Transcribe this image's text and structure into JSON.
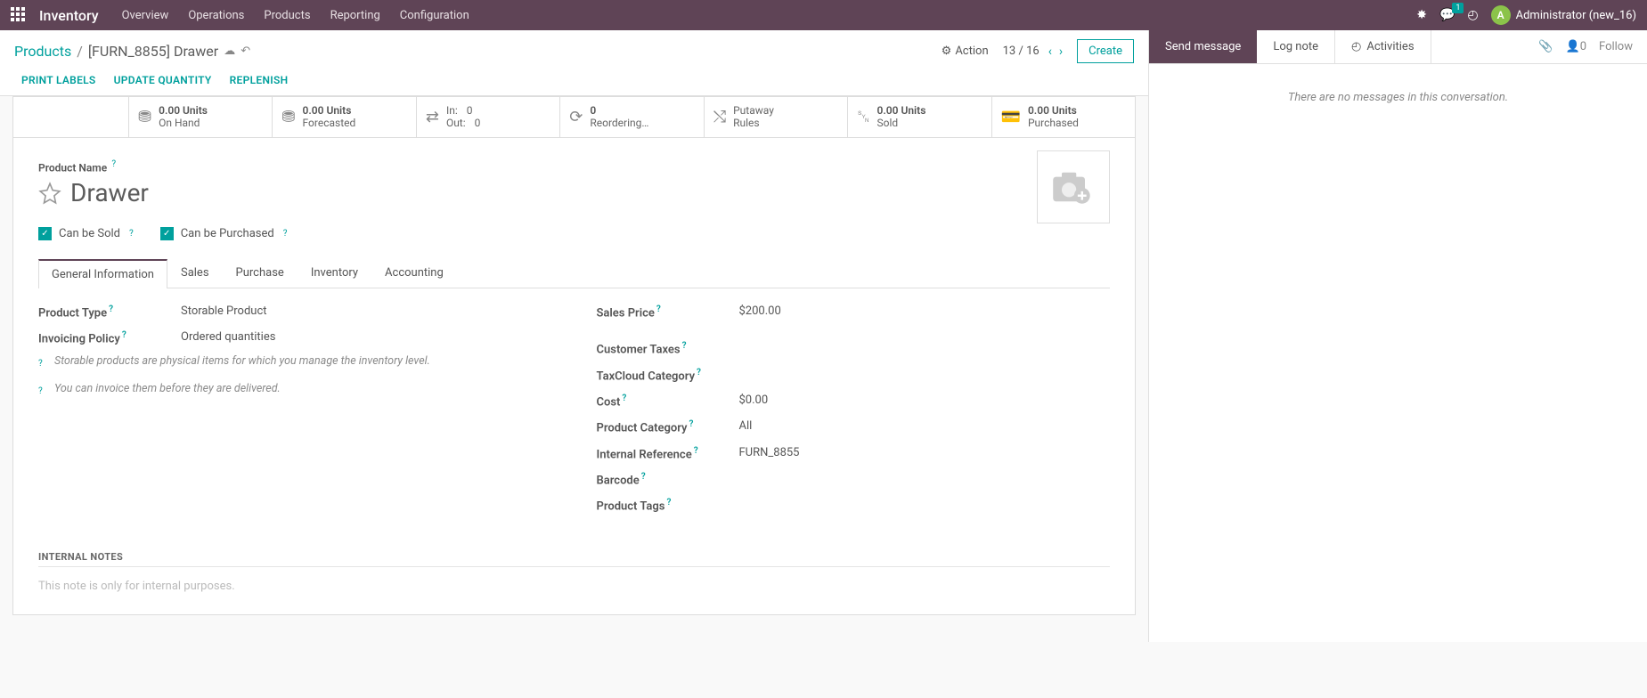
{
  "navbar": {
    "app_title": "Inventory",
    "menu": [
      "Overview",
      "Operations",
      "Products",
      "Reporting",
      "Configuration"
    ],
    "messages_badge": "1",
    "user_initial": "A",
    "user_name": "Administrator (new_16)"
  },
  "control_panel": {
    "breadcrumb_root": "Products",
    "breadcrumb_title": "[FURN_8855] Drawer",
    "action_label": "Action",
    "pager_current": "13",
    "pager_total": "16",
    "create_label": "Create",
    "buttons": {
      "print_labels": "Print Labels",
      "update_quantity": "Update Quantity",
      "replenish": "Replenish"
    }
  },
  "stats": {
    "on_hand": {
      "value": "0.00 Units",
      "label": "On Hand"
    },
    "forecasted": {
      "value": "0.00 Units",
      "label": "Forecasted"
    },
    "in_label": "In:",
    "in_val": "0",
    "out_label": "Out:",
    "out_val": "0",
    "reorder_val": "0",
    "reorder_label": "Reordering…",
    "putaway_label": "Putaway",
    "putaway_sub": "Rules",
    "sold_val": "0.00 Units",
    "sold_label": "Sold",
    "purchased_val": "0.00 Units",
    "purchased_label": "Purchased"
  },
  "form": {
    "product_name_label": "Product Name",
    "product_title": "Drawer",
    "can_be_sold": "Can be Sold",
    "can_be_purchased": "Can be Purchased",
    "tabs": [
      "General Information",
      "Sales",
      "Purchase",
      "Inventory",
      "Accounting"
    ],
    "left": {
      "product_type_label": "Product Type",
      "product_type_value": "Storable Product",
      "invoicing_policy_label": "Invoicing Policy",
      "invoicing_policy_value": "Ordered quantities",
      "hint1": "Storable products are physical items for which you manage the inventory level.",
      "hint2": "You can invoice them before they are delivered."
    },
    "right": {
      "sales_price_label": "Sales Price",
      "sales_price_value": "$200.00",
      "customer_taxes_label": "Customer Taxes",
      "taxcloud_label": "TaxCloud Category",
      "cost_label": "Cost",
      "cost_value": "$0.00",
      "product_category_label": "Product Category",
      "product_category_value": "All",
      "internal_ref_label": "Internal Reference",
      "internal_ref_value": "FURN_8855",
      "barcode_label": "Barcode",
      "product_tags_label": "Product Tags"
    },
    "notes_header": "INTERNAL NOTES",
    "notes_placeholder": "This note is only for internal purposes."
  },
  "chatter": {
    "send_message": "Send message",
    "log_note": "Log note",
    "activities": "Activities",
    "followers_count": "0",
    "follow_label": "Follow",
    "empty": "There are no messages in this conversation."
  }
}
